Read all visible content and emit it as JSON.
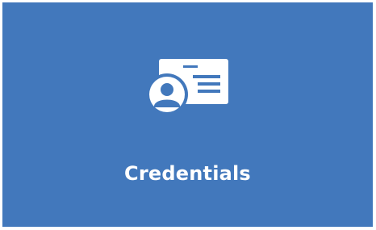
{
  "tile": {
    "label": "Credentials",
    "icon": "id-card-icon",
    "background_color": "#4278bc",
    "foreground_color": "#ffffff"
  }
}
